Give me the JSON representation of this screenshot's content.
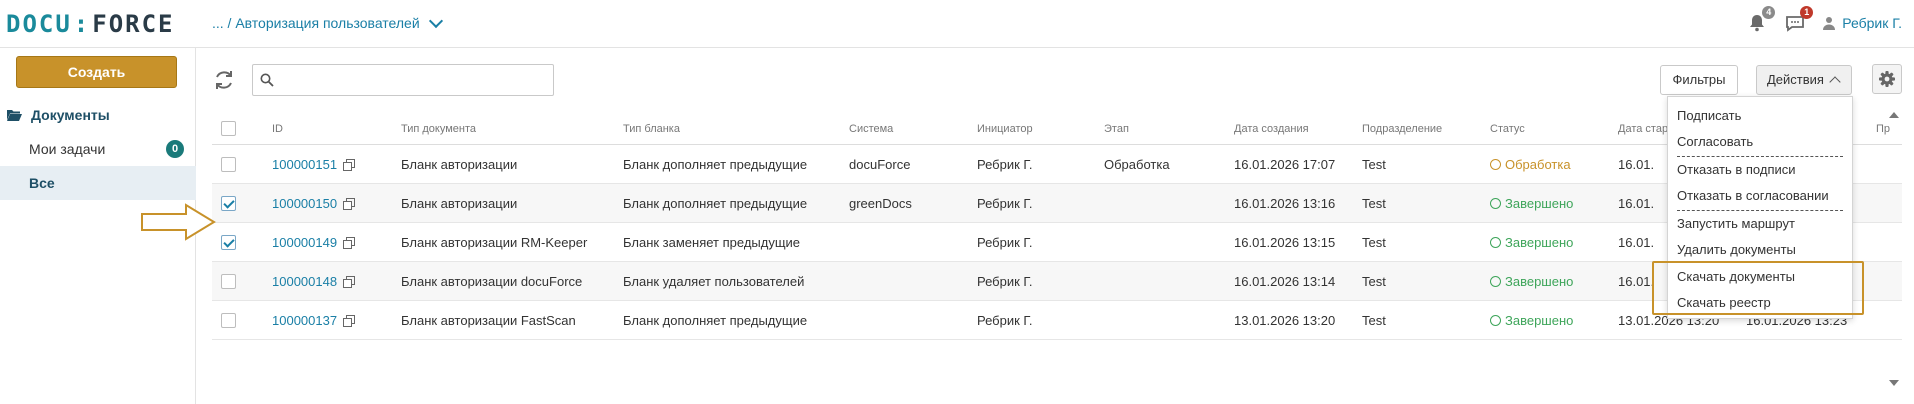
{
  "header": {
    "logo_left": "DOCU",
    "logo_right": "FORCE",
    "breadcrumb": "... / Авторизация пользователей",
    "notifications_badge": "4",
    "messages_badge": "1",
    "user_name": "Ребрик Г."
  },
  "sidebar": {
    "create_label": "Создать",
    "documents_label": "Документы",
    "my_tasks_label": "Мои задачи",
    "my_tasks_count": "0",
    "all_label": "Все"
  },
  "toolbar": {
    "search_value": "",
    "filters_label": "Фильтры",
    "actions_label": "Действия"
  },
  "table": {
    "columns": [
      "ID",
      "Тип документа",
      "Тип бланка",
      "Система",
      "Инициатор",
      "Этап",
      "Дата создания",
      "Подразделение",
      "Статус",
      "Дата стар",
      "",
      "Пр"
    ],
    "rows": [
      {
        "id": "100000151",
        "doc_type": "Бланк авторизации",
        "form_type": "Бланк дополняет предыдущие",
        "system": "docuForce",
        "initiator": "Ребрик Г.",
        "stage": "Обработка",
        "created": "16.01.2026 17:07",
        "dept": "Test",
        "status": "Обработка",
        "start": "16.01.",
        "extra": "",
        "checked": false,
        "status_kind": "proc"
      },
      {
        "id": "100000150",
        "doc_type": "Бланк авторизации",
        "form_type": "Бланк дополняет предыдущие",
        "system": "greenDocs",
        "initiator": "Ребрик Г.",
        "stage": "",
        "created": "16.01.2026 13:16",
        "dept": "Test",
        "status": "Завершено",
        "start": "16.01.",
        "extra": "",
        "checked": true,
        "status_kind": "done"
      },
      {
        "id": "100000149",
        "doc_type": "Бланк авторизации RM-Keeper",
        "form_type": "Бланк заменяет предыдущие",
        "system": "",
        "initiator": "Ребрик Г.",
        "stage": "",
        "created": "16.01.2026 13:15",
        "dept": "Test",
        "status": "Завершено",
        "start": "16.01.",
        "extra": "",
        "checked": true,
        "status_kind": "done"
      },
      {
        "id": "100000148",
        "doc_type": "Бланк авторизации docuForce",
        "form_type": "Бланк удаляет пользователей",
        "system": "",
        "initiator": "Ребрик Г.",
        "stage": "",
        "created": "16.01.2026 13:14",
        "dept": "Test",
        "status": "Завершено",
        "start": "16.01.",
        "extra": "",
        "checked": false,
        "status_kind": "done"
      },
      {
        "id": "100000137",
        "doc_type": "Бланк авторизации FastScan",
        "form_type": "Бланк дополняет предыдущие",
        "system": "",
        "initiator": "Ребрик Г.",
        "stage": "",
        "created": "13.01.2026 13:20",
        "dept": "Test",
        "status": "Завершено",
        "start": "13.01.2026 13:20",
        "extra": "16.01.2026 13:23",
        "checked": false,
        "status_kind": "done"
      }
    ]
  },
  "actions_menu": {
    "items": [
      "Подписать",
      "Согласовать",
      "Отказать в подписи",
      "Отказать в согласовании",
      "Запустить маршрут",
      "Удалить документы",
      "Скачать документы",
      "Скачать реестр"
    ]
  },
  "colors": {
    "accent": "#c8922a",
    "link": "#1a7fa6",
    "done": "#3ea55a"
  }
}
